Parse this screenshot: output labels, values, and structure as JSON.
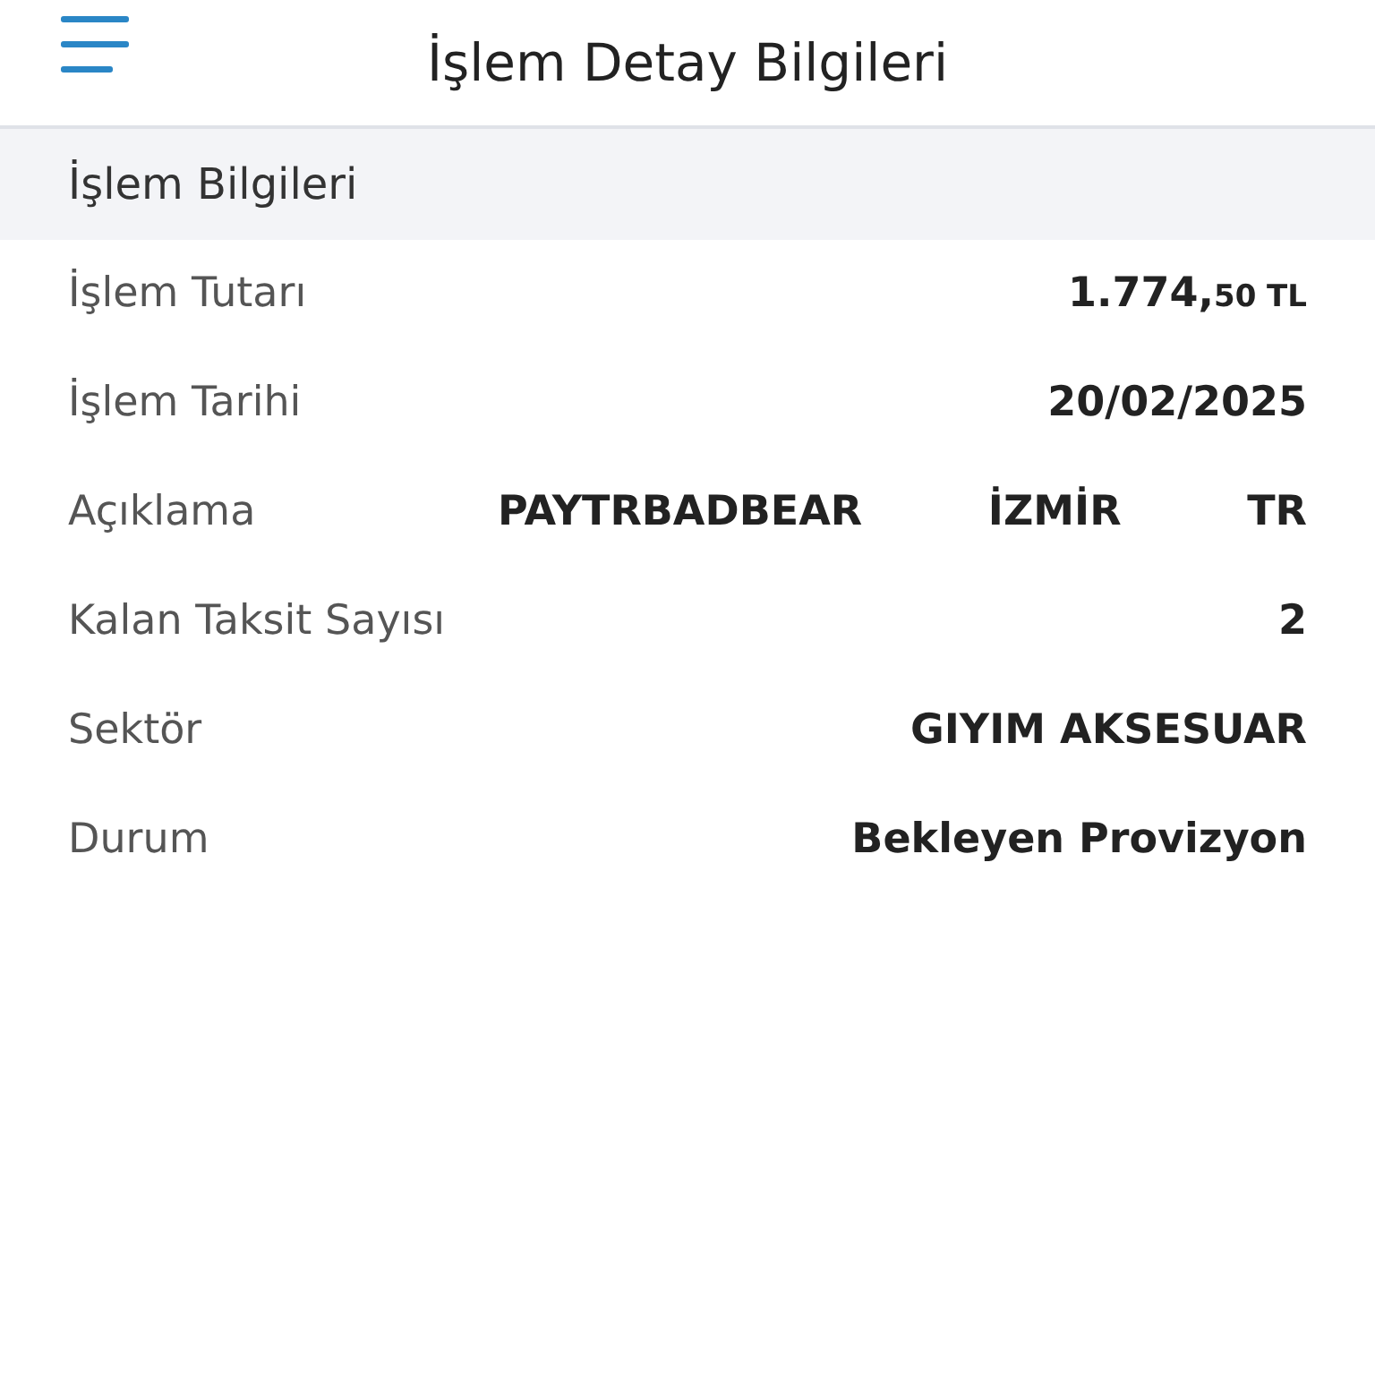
{
  "header": {
    "title": "İşlem Detay Bilgileri"
  },
  "section": {
    "title": "İşlem Bilgileri"
  },
  "rows": [
    {
      "kind": "amount",
      "label": "İşlem Tutarı",
      "main": "1.774,",
      "fraction": "50",
      "currency": "TL"
    },
    {
      "kind": "text",
      "label": "İşlem Tarihi",
      "value": "20/02/2025"
    },
    {
      "kind": "multi",
      "label": "Açıklama",
      "values": [
        "PAYTRBADBEAR",
        "İZMİR",
        "TR"
      ]
    },
    {
      "kind": "text",
      "label": "Kalan Taksit Sayısı",
      "value": "2"
    },
    {
      "kind": "text",
      "label": "Sektör",
      "value": "GIYIM AKSESUAR"
    },
    {
      "kind": "text",
      "label": "Durum",
      "value": "Bekleyen Provizyon"
    }
  ]
}
